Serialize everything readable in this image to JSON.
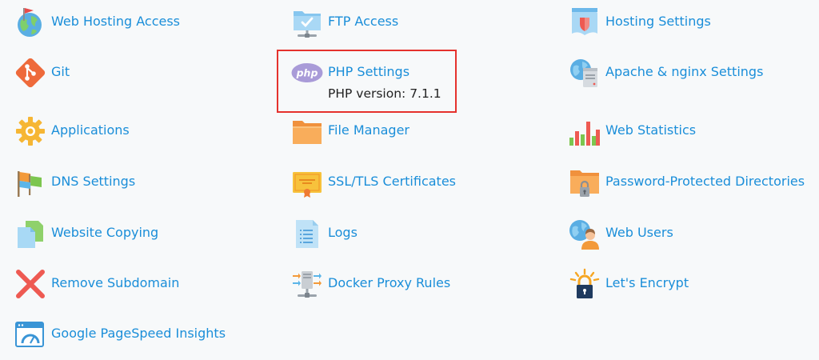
{
  "columns": {
    "left": [
      {
        "label": "Web Hosting Access",
        "icon": "globe-flag-icon"
      },
      {
        "label": "Git",
        "icon": "git-icon"
      },
      {
        "label": "Applications",
        "icon": "gear-icon"
      },
      {
        "label": "DNS Settings",
        "icon": "flags-icon"
      },
      {
        "label": "Website Copying",
        "icon": "copy-pages-icon"
      },
      {
        "label": "Remove Subdomain",
        "icon": "red-x-icon"
      },
      {
        "label": "Google PageSpeed Insights",
        "icon": "speedometer-window-icon"
      }
    ],
    "middle": [
      {
        "label": "FTP Access",
        "icon": "ftp-folder-icon"
      },
      {
        "label": "PHP Settings",
        "icon": "php-icon",
        "sub": "PHP version: 7.1.1"
      },
      {
        "label": "File Manager",
        "icon": "folder-icon"
      },
      {
        "label": "SSL/TLS Certificates",
        "icon": "certificate-icon"
      },
      {
        "label": "Logs",
        "icon": "log-document-icon"
      },
      {
        "label": "Docker Proxy Rules",
        "icon": "docker-proxy-icon"
      }
    ],
    "right": [
      {
        "label": "Hosting Settings",
        "icon": "hosting-settings-icon"
      },
      {
        "label": "Apache & nginx Settings",
        "icon": "apache-nginx-icon"
      },
      {
        "label": "Web Statistics",
        "icon": "bar-stats-icon"
      },
      {
        "label": "Password-Protected Directories",
        "icon": "locked-folder-icon"
      },
      {
        "label": "Web Users",
        "icon": "web-user-icon"
      },
      {
        "label": "Let's Encrypt",
        "icon": "lets-encrypt-lock-icon"
      }
    ]
  },
  "colors": {
    "link": "#1a8ed9",
    "highlight_border": "#e5322d",
    "background": "#f7f9fa"
  }
}
